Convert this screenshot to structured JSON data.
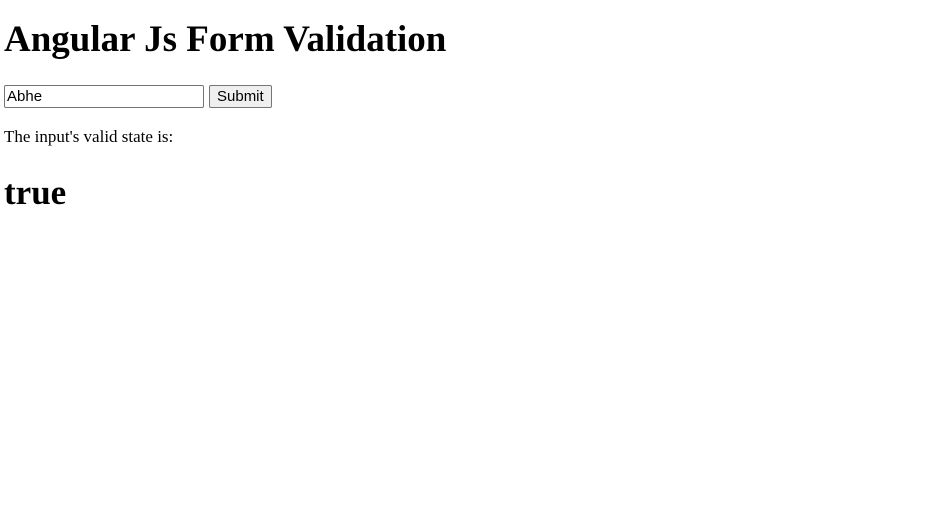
{
  "page": {
    "heading": "Angular Js Form Validation"
  },
  "form": {
    "input_value": "Abhe",
    "submit_label": "Submit"
  },
  "result": {
    "label": "The input's valid state is:",
    "value": "true"
  }
}
